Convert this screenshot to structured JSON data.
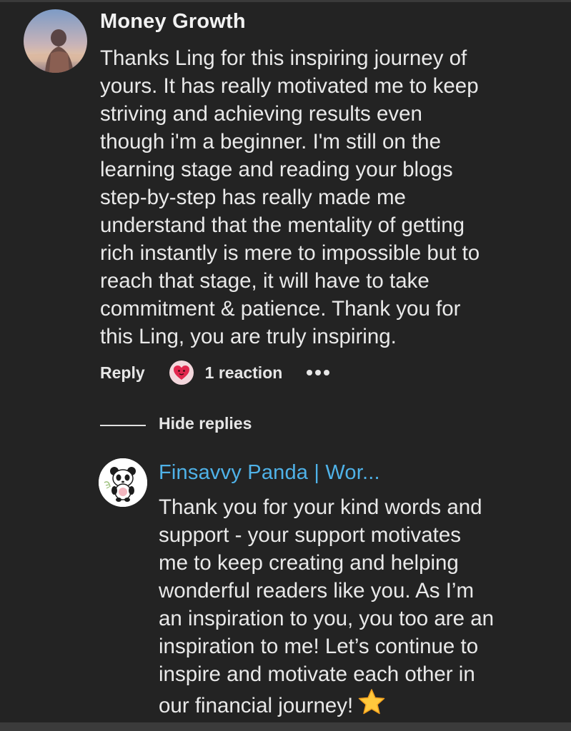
{
  "comment": {
    "author": "Money Growth",
    "avatar_icon": "profile-photo-icon",
    "body": "Thanks Ling for this inspiring journey of\nyours. It has really motivated me to keep\nstriving and achieving results even\nthough i'm a beginner. I'm still on the\nlearning stage and reading your blogs\nstep-by-step has really made me\nunderstand that the mentality of getting\nrich instantly is mere to impossible but to\nreach that stage, it will have to take\ncommitment & patience. Thank you for\nthis Ling, you are truly inspiring.",
    "actions": {
      "reply_label": "Reply",
      "reaction_icon": "heart-face-icon",
      "reaction_label": "1 reaction",
      "more_icon": "more-options-icon"
    }
  },
  "thread": {
    "hide_replies_label": "Hide replies"
  },
  "reply": {
    "author": "Finsavvy Panda | Wor...",
    "author_color": "#4fb2e8",
    "avatar_icon": "panda-logo-icon",
    "body": "Thank you for your kind words and\nsupport - your support motivates\nme to keep creating and helping\nwonderful readers like you. As I’m\nan inspiration to you, you too are an\ninspiration to me! Let’s continue to\ninspire and motivate each other in\nour financial journey!",
    "emoji_icon": "star-icon"
  },
  "colors": {
    "background": "#232323",
    "text": "#e9e9e9",
    "link": "#4fb2e8"
  }
}
